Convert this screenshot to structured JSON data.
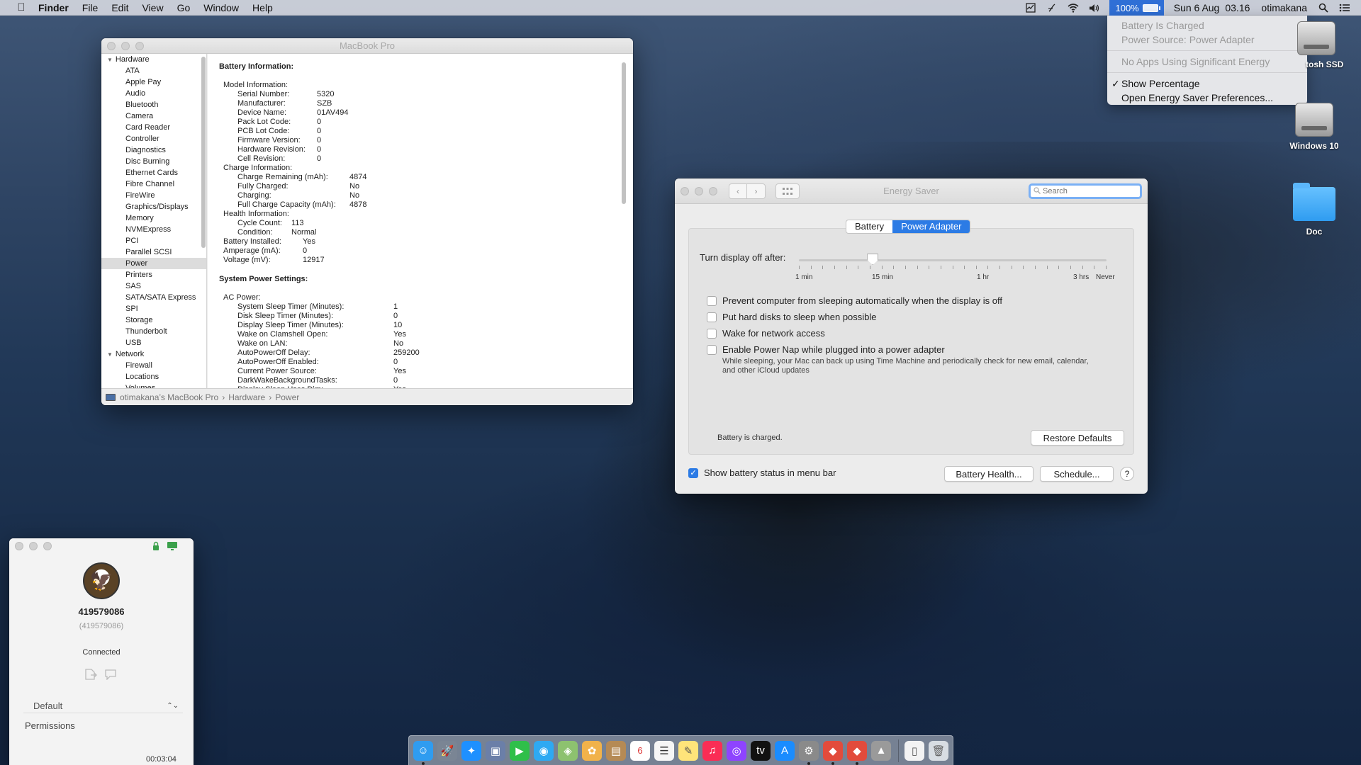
{
  "menubar": {
    "app": "Finder",
    "items": [
      "File",
      "Edit",
      "View",
      "Go",
      "Window",
      "Help"
    ],
    "battery_percent": "100%",
    "date": "Sun 6 Aug",
    "time": "03.16",
    "user": "otimakana",
    "status_icons": [
      "activity-monitor-icon",
      "script-icon",
      "wifi-icon",
      "volume-icon"
    ]
  },
  "battery_menu": {
    "status": "Battery Is Charged",
    "source": "Power Source: Power Adapter",
    "apps": "No Apps Using Significant Energy",
    "show_percentage": "Show Percentage",
    "open_prefs": "Open Energy Saver Preferences..."
  },
  "desktop": {
    "icons": [
      {
        "label": "tosh SSD"
      },
      {
        "label": "Windows 10"
      },
      {
        "label": "Doc"
      }
    ]
  },
  "sysinfo": {
    "title": "MacBook Pro",
    "sidebar": {
      "hardware": "Hardware",
      "hardware_items": [
        "ATA",
        "Apple Pay",
        "Audio",
        "Bluetooth",
        "Camera",
        "Card Reader",
        "Controller",
        "Diagnostics",
        "Disc Burning",
        "Ethernet Cards",
        "Fibre Channel",
        "FireWire",
        "Graphics/Displays",
        "Memory",
        "NVMExpress",
        "PCI",
        "Parallel SCSI",
        "Power",
        "Printers",
        "SAS",
        "SATA/SATA Express",
        "SPI",
        "Storage",
        "Thunderbolt",
        "USB"
      ],
      "network": "Network",
      "network_items": [
        "Firewall",
        "Locations",
        "Volumes"
      ]
    },
    "battery_header": "Battery Information:",
    "model_header": "Model Information:",
    "model": [
      {
        "k": "Serial Number:",
        "v": "5320"
      },
      {
        "k": "Manufacturer:",
        "v": "SZB"
      },
      {
        "k": "Device Name:",
        "v": "01AV494"
      },
      {
        "k": "Pack Lot Code:",
        "v": "0"
      },
      {
        "k": "PCB Lot Code:",
        "v": "0"
      },
      {
        "k": "Firmware Version:",
        "v": "0"
      },
      {
        "k": "Hardware Revision:",
        "v": "0"
      },
      {
        "k": "Cell Revision:",
        "v": "0"
      }
    ],
    "charge_header": "Charge Information:",
    "charge": [
      {
        "k": "Charge Remaining (mAh):",
        "v": "4874"
      },
      {
        "k": "Fully Charged:",
        "v": "No"
      },
      {
        "k": "Charging:",
        "v": "No"
      },
      {
        "k": "Full Charge Capacity (mAh):",
        "v": "4878"
      }
    ],
    "health_header": "Health Information:",
    "health": [
      {
        "k": "Cycle Count:",
        "v": "113"
      },
      {
        "k": "Condition:",
        "v": "Normal"
      }
    ],
    "top": [
      {
        "k": "Battery Installed:",
        "v": "Yes"
      },
      {
        "k": "Amperage (mA):",
        "v": "0"
      },
      {
        "k": "Voltage (mV):",
        "v": "12917"
      }
    ],
    "power_header": "System Power Settings:",
    "ac_header": "AC Power:",
    "ac": [
      {
        "k": "System Sleep Timer (Minutes):",
        "v": "1"
      },
      {
        "k": "Disk Sleep Timer (Minutes):",
        "v": "0"
      },
      {
        "k": "Display Sleep Timer (Minutes):",
        "v": "10"
      },
      {
        "k": "Wake on Clamshell Open:",
        "v": "Yes"
      },
      {
        "k": "Wake on LAN:",
        "v": "No"
      },
      {
        "k": "AutoPowerOff Delay:",
        "v": "259200"
      },
      {
        "k": "AutoPowerOff Enabled:",
        "v": "0"
      },
      {
        "k": "Current Power Source:",
        "v": "Yes"
      },
      {
        "k": "DarkWakeBackgroundTasks:",
        "v": "0"
      },
      {
        "k": "Display Sleep Uses Dim:",
        "v": "Yes"
      }
    ],
    "path": [
      "otimakana’s MacBook Pro",
      "Hardware",
      "Power"
    ]
  },
  "energy": {
    "title": "Energy Saver",
    "search_placeholder": "Search",
    "tab_battery": "Battery",
    "tab_adapter": "Power Adapter",
    "slider_label": "Turn display off after:",
    "slider_value_fraction": 0.24,
    "ticks": [
      "1 min",
      "15 min",
      "1 hr",
      "3 hrs",
      "Never"
    ],
    "options": [
      {
        "label": "Prevent computer from sleeping automatically when the display is off",
        "checked": false
      },
      {
        "label": "Put hard disks to sleep when possible",
        "checked": false
      },
      {
        "label": "Wake for network access",
        "checked": false
      },
      {
        "label": "Enable Power Nap while plugged into a power adapter",
        "checked": false
      }
    ],
    "powernap_sub": "While sleeping, your Mac can back up using Time Machine and periodically check for new email, calendar, and other iCloud updates",
    "charged": "Battery is charged.",
    "restore": "Restore Defaults",
    "show_status": "Show battery status in menu bar",
    "battery_health": "Battery Health...",
    "schedule": "Schedule...",
    "help": "?"
  },
  "phone": {
    "number": "419579086",
    "number_paren": "(419579086)",
    "status": "Connected",
    "select": "Default",
    "permissions": "Permissions",
    "timer": "00:03:04"
  },
  "dock": {
    "colors": {
      "finder": "#2f9cf0",
      "safari": "#1e90ff",
      "facetime": "#2fbf4a",
      "music": "#fa2d55",
      "podcasts": "#8e44ff",
      "tv": "#111111",
      "appstore": "#1a8cff",
      "settings": "#8a8a8a",
      "git": "#e24b3c"
    }
  }
}
